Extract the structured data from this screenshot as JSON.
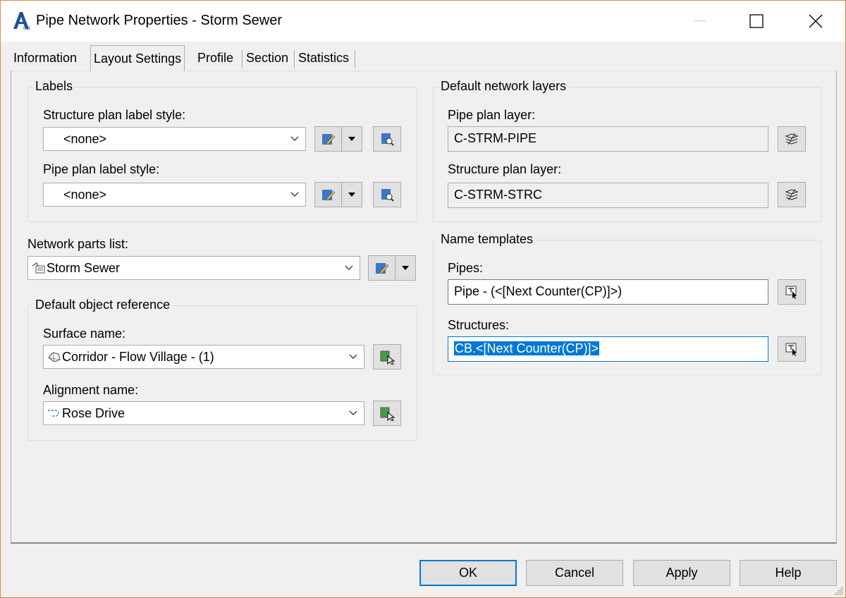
{
  "window": {
    "title": "Pipe Network Properties - Storm Sewer",
    "accent": "#0078d7",
    "border_color": "#e3893a"
  },
  "tabs": [
    {
      "label": "Information",
      "active": false
    },
    {
      "label": "Layout Settings",
      "active": true
    },
    {
      "label": "Profile",
      "active": false
    },
    {
      "label": "Section",
      "active": false
    },
    {
      "label": "Statistics",
      "active": false
    }
  ],
  "labels_group": {
    "title": "Labels",
    "structure_label": "Structure plan label style:",
    "structure_value": "<none>",
    "pipe_label": "Pipe plan label style:",
    "pipe_value": "<none>"
  },
  "parts_list": {
    "label": "Network parts list:",
    "value": "Storm Sewer",
    "icon": "parts-list-icon"
  },
  "object_ref": {
    "title": "Default object reference",
    "surface_label": "Surface name:",
    "surface_value": "Corridor - Flow Village - (1)",
    "surface_icon": "surface-icon",
    "alignment_label": "Alignment name:",
    "alignment_value": "Rose Drive",
    "alignment_icon": "alignment-icon"
  },
  "layers": {
    "title": "Default network layers",
    "pipe_label": "Pipe plan layer:",
    "pipe_value": "C-STRM-PIPE",
    "structure_label": "Structure plan layer:",
    "structure_value": "C-STRM-STRC"
  },
  "name_templates": {
    "title": "Name templates",
    "pipes_label": "Pipes:",
    "pipes_value": "Pipe - (<[Next Counter(CP)]>)",
    "structures_label": "Structures:",
    "structures_value": "CB.<[Next Counter(CP)]>"
  },
  "buttons": {
    "ok": "OK",
    "cancel": "Cancel",
    "apply": "Apply",
    "help": "Help"
  }
}
